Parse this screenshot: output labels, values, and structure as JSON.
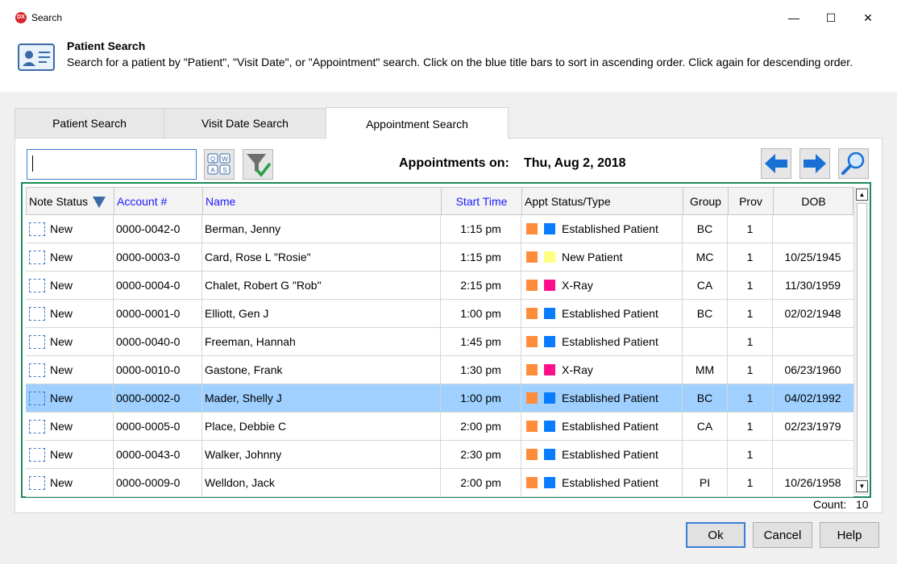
{
  "window": {
    "title": "Search",
    "app_icon_text": "DX",
    "minimize_glyph": "—",
    "maximize_glyph": "☐",
    "close_glyph": "✕"
  },
  "header": {
    "title": "Patient Search",
    "description": "Search for a patient by \"Patient\", \"Visit Date\", or \"Appointment\" search.  Click on the blue title bars to sort in ascending order.  Click again for descending order."
  },
  "tabs": [
    {
      "label": "Patient Search",
      "active": false
    },
    {
      "label": "Visit Date Search",
      "active": false
    },
    {
      "label": "Appointment Search",
      "active": true
    }
  ],
  "search": {
    "value": "",
    "placeholder": ""
  },
  "appointments": {
    "label": "Appointments on:",
    "date": "Thu, Aug 2, 2018"
  },
  "grid": {
    "columns": {
      "note_status": "Note Status",
      "account": "Account #",
      "name": "Name",
      "start_time": "Start Time",
      "appt_status": "Appt Status/Type",
      "group": "Group",
      "prov": "Prov",
      "dob": "DOB"
    },
    "rows": [
      {
        "note": "New",
        "account": "0000-0042-0",
        "name": "Berman, Jenny",
        "time": "1:15 pm",
        "type": "Established Patient",
        "color": "#0a7cff",
        "group": "BC",
        "prov": "1",
        "dob": ""
      },
      {
        "note": "New",
        "account": "0000-0003-0",
        "name": "Card, Rose L \"Rosie\"",
        "time": "1:15 pm",
        "type": "New Patient",
        "color": "#ffff80",
        "group": "MC",
        "prov": "1",
        "dob": "10/25/1945"
      },
      {
        "note": "New",
        "account": "0000-0004-0",
        "name": "Chalet, Robert G \"Rob\"",
        "time": "2:15 pm",
        "type": "X-Ray",
        "color": "#ff0f8a",
        "group": "CA",
        "prov": "1",
        "dob": "11/30/1959"
      },
      {
        "note": "New",
        "account": "0000-0001-0",
        "name": "Elliott, Gen J",
        "time": "1:00 pm",
        "type": "Established Patient",
        "color": "#0a7cff",
        "group": "BC",
        "prov": "1",
        "dob": "02/02/1948"
      },
      {
        "note": "New",
        "account": "0000-0040-0",
        "name": "Freeman, Hannah",
        "time": "1:45 pm",
        "type": "Established Patient",
        "color": "#0a7cff",
        "group": "",
        "prov": "1",
        "dob": ""
      },
      {
        "note": "New",
        "account": "0000-0010-0",
        "name": "Gastone, Frank",
        "time": "1:30 pm",
        "type": "X-Ray",
        "color": "#ff0f8a",
        "group": "MM",
        "prov": "1",
        "dob": "06/23/1960"
      },
      {
        "note": "New",
        "account": "0000-0002-0",
        "name": "Mader, Shelly J",
        "time": "1:00 pm",
        "type": "Established Patient",
        "color": "#0a7cff",
        "group": "BC",
        "prov": "1",
        "dob": "04/02/1992",
        "selected": true
      },
      {
        "note": "New",
        "account": "0000-0005-0",
        "name": "Place, Debbie C",
        "time": "2:00 pm",
        "type": "Established Patient",
        "color": "#0a7cff",
        "group": "CA",
        "prov": "1",
        "dob": "02/23/1979"
      },
      {
        "note": "New",
        "account": "0000-0043-0",
        "name": "Walker, Johnny",
        "time": "2:30 pm",
        "type": "Established Patient",
        "color": "#0a7cff",
        "group": "",
        "prov": "1",
        "dob": ""
      },
      {
        "note": "New",
        "account": "0000-0009-0",
        "name": "Welldon, Jack",
        "time": "2:00 pm",
        "type": "Established Patient",
        "color": "#0a7cff",
        "group": "PI",
        "prov": "1",
        "dob": "10/26/1958"
      }
    ]
  },
  "status_colors": {
    "arrival": "#ff8c3a"
  },
  "count": {
    "label": "Count:",
    "value": "10"
  },
  "buttons": {
    "ok": "Ok",
    "cancel": "Cancel",
    "help": "Help"
  },
  "icons": {
    "keyboard": "keyboard-icon",
    "filter": "filter-check-icon",
    "prev": "arrow-left-icon",
    "next": "arrow-right-icon",
    "search": "magnifier-icon"
  }
}
